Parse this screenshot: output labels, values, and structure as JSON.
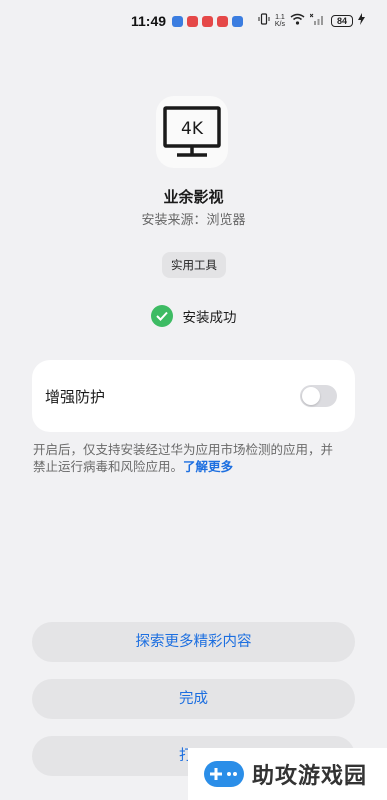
{
  "status_bar": {
    "time": "11:49",
    "net_speed_value": "1.1",
    "net_speed_unit": "K/s",
    "battery": "84",
    "notification_colors": [
      "#3b7de0",
      "#e54848",
      "#e54848",
      "#e54848",
      "#3b7de0"
    ]
  },
  "app": {
    "icon": "monitor-4k-icon",
    "icon_text": "4K",
    "name": "业余影视",
    "source": "安装来源：浏览器",
    "category": "实用工具"
  },
  "result": {
    "status": "安装成功",
    "icon": "check-circle-icon"
  },
  "protection": {
    "title": "增强防护",
    "enabled": false,
    "description": "开启后，仅支持安装经过华为应用市场检测的应用，并禁止运行病毒和风险应用。",
    "link": "了解更多"
  },
  "actions": {
    "explore": "探索更多精彩内容",
    "done": "完成",
    "open": "打开"
  },
  "watermark": {
    "text": "助攻游戏园",
    "icon": "gamepad-icon"
  },
  "colors": {
    "accent": "#1d6fe0",
    "success": "#3dbb63",
    "background": "#f1f1f3"
  }
}
